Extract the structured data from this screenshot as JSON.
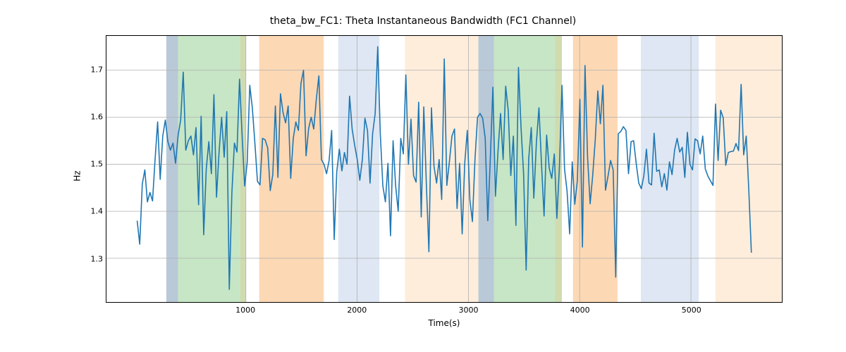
{
  "chart_data": {
    "type": "line",
    "title": "theta_bw_FC1: Theta Instantaneous Bandwidth (FC1 Channel)",
    "xlabel": "Time(s)",
    "ylabel": "Hz",
    "xlim": [
      -253,
      5817
    ],
    "ylim": [
      1.207,
      1.773
    ],
    "xticks": [
      1000,
      2000,
      3000,
      4000,
      5000
    ],
    "yticks": [
      1.3,
      1.4,
      1.5,
      1.6,
      1.7
    ],
    "bands": [
      {
        "start": 285,
        "end": 390,
        "color": "slate"
      },
      {
        "start": 390,
        "end": 950,
        "color": "green"
      },
      {
        "start": 950,
        "end": 1000,
        "color": "olive"
      },
      {
        "start": 1120,
        "end": 1700,
        "color": "orange"
      },
      {
        "start": 1830,
        "end": 2200,
        "color": "lightblue"
      },
      {
        "start": 2430,
        "end": 3090,
        "color": "wheat"
      },
      {
        "start": 3090,
        "end": 3230,
        "color": "slate"
      },
      {
        "start": 3230,
        "end": 3780,
        "color": "green"
      },
      {
        "start": 3780,
        "end": 3840,
        "color": "olive"
      },
      {
        "start": 3940,
        "end": 4340,
        "color": "orange"
      },
      {
        "start": 4550,
        "end": 5070,
        "color": "lightblue"
      },
      {
        "start": 5220,
        "end": 5817,
        "color": "wheat"
      }
    ],
    "band_colors": {
      "slate": "rgba(115,148,177,0.50)",
      "green": "rgba(152,210,150,0.55)",
      "olive": "rgba(170,190,110,0.55)",
      "orange": "rgba(250,190,130,0.60)",
      "lightblue": "rgba(200,215,235,0.60)",
      "wheat": "rgba(253,225,195,0.60)"
    },
    "line_color": "#1f77b4",
    "x": [
      23,
      46,
      69,
      92,
      115,
      138,
      161,
      184,
      207,
      230,
      253,
      276,
      299,
      322,
      345,
      368,
      391,
      414,
      437,
      460,
      483,
      506,
      529,
      552,
      575,
      598,
      621,
      644,
      667,
      690,
      713,
      736,
      759,
      782,
      805,
      828,
      851,
      874,
      897,
      920,
      943,
      966,
      989,
      1012,
      1035,
      1058,
      1081,
      1104,
      1127,
      1150,
      1173,
      1196,
      1219,
      1242,
      1265,
      1288,
      1311,
      1334,
      1357,
      1380,
      1403,
      1426,
      1449,
      1472,
      1495,
      1518,
      1541,
      1564,
      1587,
      1610,
      1633,
      1656,
      1679,
      1702,
      1725,
      1748,
      1771,
      1794,
      1817,
      1840,
      1863,
      1886,
      1909,
      1932,
      1955,
      1978,
      2001,
      2024,
      2047,
      2070,
      2093,
      2116,
      2139,
      2162,
      2185,
      2208,
      2231,
      2254,
      2277,
      2300,
      2323,
      2346,
      2369,
      2392,
      2415,
      2438,
      2461,
      2484,
      2507,
      2530,
      2553,
      2576,
      2599,
      2622,
      2645,
      2668,
      2691,
      2714,
      2737,
      2760,
      2783,
      2806,
      2829,
      2852,
      2875,
      2898,
      2921,
      2944,
      2967,
      2990,
      3013,
      3036,
      3059,
      3082,
      3105,
      3128,
      3151,
      3174,
      3197,
      3220,
      3243,
      3266,
      3289,
      3312,
      3335,
      3358,
      3381,
      3404,
      3427,
      3450,
      3473,
      3496,
      3519,
      3542,
      3565,
      3588,
      3611,
      3634,
      3657,
      3680,
      3703,
      3726,
      3749,
      3772,
      3795,
      3818,
      3841,
      3864,
      3887,
      3910,
      3933,
      3956,
      3979,
      4002,
      4025,
      4048,
      4071,
      4094,
      4117,
      4140,
      4163,
      4186,
      4209,
      4232,
      4255,
      4278,
      4301,
      4324,
      4347,
      4370,
      4393,
      4416,
      4439,
      4462,
      4485,
      4508,
      4531,
      4554,
      4577,
      4600,
      4623,
      4646,
      4669,
      4692,
      4715,
      4738,
      4761,
      4784,
      4807,
      4830,
      4853,
      4876,
      4899,
      4922,
      4945,
      4968,
      4991,
      5014,
      5037,
      5060,
      5083,
      5106,
      5129,
      5152,
      5175,
      5198,
      5221,
      5244,
      5267,
      5290,
      5313,
      5336,
      5359,
      5382,
      5405,
      5428,
      5451,
      5474,
      5497,
      5520,
      5543
    ],
    "y": [
      1.38,
      1.33,
      1.458,
      1.488,
      1.42,
      1.44,
      1.422,
      1.51,
      1.59,
      1.468,
      1.56,
      1.594,
      1.548,
      1.53,
      1.545,
      1.502,
      1.562,
      1.594,
      1.696,
      1.53,
      1.55,
      1.56,
      1.52,
      1.578,
      1.414,
      1.602,
      1.35,
      1.49,
      1.548,
      1.48,
      1.648,
      1.43,
      1.525,
      1.6,
      1.515,
      1.612,
      1.234,
      1.438,
      1.545,
      1.526,
      1.681,
      1.562,
      1.454,
      1.504,
      1.668,
      1.62,
      1.545,
      1.464,
      1.456,
      1.555,
      1.552,
      1.535,
      1.444,
      1.478,
      1.624,
      1.472,
      1.65,
      1.61,
      1.588,
      1.624,
      1.47,
      1.555,
      1.59,
      1.572,
      1.672,
      1.7,
      1.518,
      1.576,
      1.6,
      1.575,
      1.638,
      1.688,
      1.51,
      1.5,
      1.48,
      1.508,
      1.572,
      1.34,
      1.484,
      1.532,
      1.486,
      1.525,
      1.5,
      1.645,
      1.575,
      1.54,
      1.51,
      1.466,
      1.51,
      1.598,
      1.572,
      1.46,
      1.565,
      1.608,
      1.75,
      1.565,
      1.454,
      1.42,
      1.502,
      1.348,
      1.55,
      1.454,
      1.4,
      1.555,
      1.522,
      1.69,
      1.5,
      1.596,
      1.476,
      1.462,
      1.632,
      1.388,
      1.622,
      1.458,
      1.314,
      1.62,
      1.495,
      1.46,
      1.51,
      1.425,
      1.724,
      1.455,
      1.505,
      1.56,
      1.575,
      1.406,
      1.502,
      1.352,
      1.502,
      1.572,
      1.425,
      1.378,
      1.51,
      1.6,
      1.608,
      1.598,
      1.555,
      1.38,
      1.512,
      1.664,
      1.432,
      1.528,
      1.608,
      1.51,
      1.666,
      1.614,
      1.476,
      1.56,
      1.37,
      1.706,
      1.578,
      1.48,
      1.275,
      1.512,
      1.578,
      1.428,
      1.546,
      1.62,
      1.5,
      1.39,
      1.562,
      1.492,
      1.47,
      1.522,
      1.385,
      1.495,
      1.668,
      1.49,
      1.442,
      1.352,
      1.505,
      1.415,
      1.465,
      1.638,
      1.324,
      1.71,
      1.515,
      1.416,
      1.476,
      1.552,
      1.656,
      1.586,
      1.668,
      1.445,
      1.475,
      1.508,
      1.488,
      1.26,
      1.565,
      1.57,
      1.58,
      1.572,
      1.48,
      1.548,
      1.55,
      1.502,
      1.46,
      1.448,
      1.476,
      1.532,
      1.46,
      1.456,
      1.566,
      1.485,
      1.488,
      1.452,
      1.48,
      1.445,
      1.505,
      1.478,
      1.53,
      1.555,
      1.526,
      1.536,
      1.472,
      1.568,
      1.5,
      1.488,
      1.554,
      1.55,
      1.522,
      1.56,
      1.49,
      1.475,
      1.465,
      1.455,
      1.628,
      1.508,
      1.615,
      1.599,
      1.498,
      1.525,
      1.527,
      1.528,
      1.544,
      1.529,
      1.67,
      1.52,
      1.56,
      1.445,
      1.312
    ]
  }
}
